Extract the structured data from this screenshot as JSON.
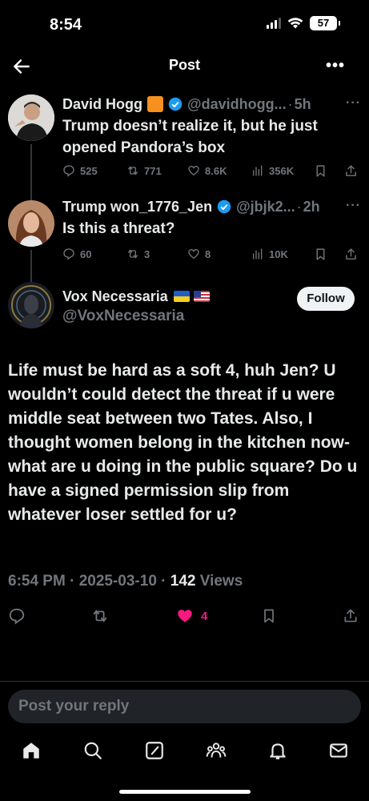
{
  "status_bar": {
    "time": "8:54",
    "battery": "57"
  },
  "header": {
    "title": "Post"
  },
  "thread": [
    {
      "name": "David Hogg",
      "handle": "@davidhogg...",
      "time": "5h",
      "text": "Trump doesn’t realize it, but he just opened Pandora’s box",
      "replies": "525",
      "reposts": "771",
      "likes": "8.6K",
      "views": "356K"
    },
    {
      "name": "Trump won_1776_Jen",
      "handle": "@jbjk2...",
      "time": "2h",
      "text": "Is this a threat?",
      "replies": "60",
      "reposts": "3",
      "likes": "8",
      "views": "10K"
    }
  ],
  "focused": {
    "name": "Vox Necessaria",
    "handle": "@VoxNecessaria",
    "follow_label": "Follow",
    "text": "Life must be hard as a soft 4, huh Jen? U wouldn’t could detect the threat if u were middle seat between two Tates. Also, I thought women belong in the kitchen now- what are u doing in the public square? Do u have a signed permission slip from whatever loser settled for u?",
    "datetime": "6:54 PM · 2025-03-10 · ",
    "views_count": "142",
    "views_label": " Views",
    "likes": "4",
    "like_color": "#f91880"
  },
  "reply": {
    "placeholder": "Post your reply"
  },
  "colors": {
    "background": "#000000",
    "text": "#e7e9ea",
    "muted": "#71767b",
    "verified": "#1d9bf0"
  },
  "icons": {
    "back": "arrow-left-icon",
    "more": "more-horizontal-icon",
    "reply": "comment-icon",
    "repost": "repost-icon",
    "like": "heart-icon",
    "views": "bar-chart-icon",
    "bookmark": "bookmark-icon",
    "share": "share-icon",
    "tabs": [
      "home-icon",
      "search-icon",
      "compose-icon",
      "communities-icon",
      "notifications-icon",
      "messages-icon"
    ]
  }
}
